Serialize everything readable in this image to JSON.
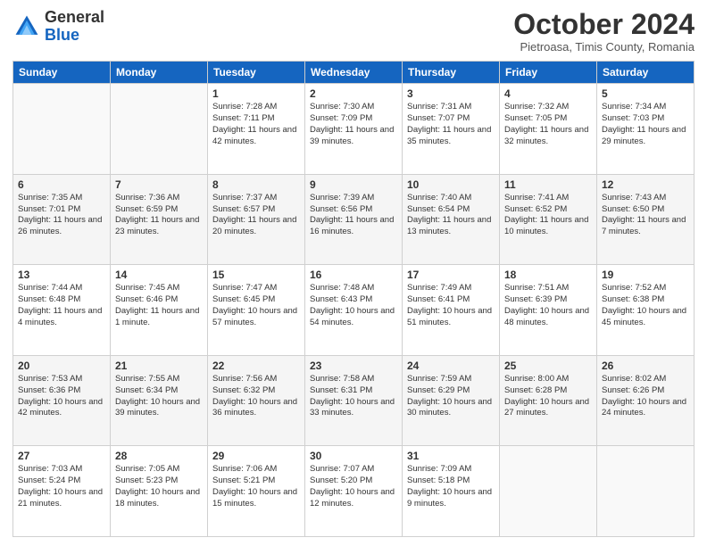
{
  "header": {
    "logo_general": "General",
    "logo_blue": "Blue",
    "month": "October 2024",
    "location": "Pietroasa, Timis County, Romania"
  },
  "days_of_week": [
    "Sunday",
    "Monday",
    "Tuesday",
    "Wednesday",
    "Thursday",
    "Friday",
    "Saturday"
  ],
  "weeks": [
    [
      {
        "day": "",
        "info": ""
      },
      {
        "day": "",
        "info": ""
      },
      {
        "day": "1",
        "info": "Sunrise: 7:28 AM\nSunset: 7:11 PM\nDaylight: 11 hours and 42 minutes."
      },
      {
        "day": "2",
        "info": "Sunrise: 7:30 AM\nSunset: 7:09 PM\nDaylight: 11 hours and 39 minutes."
      },
      {
        "day": "3",
        "info": "Sunrise: 7:31 AM\nSunset: 7:07 PM\nDaylight: 11 hours and 35 minutes."
      },
      {
        "day": "4",
        "info": "Sunrise: 7:32 AM\nSunset: 7:05 PM\nDaylight: 11 hours and 32 minutes."
      },
      {
        "day": "5",
        "info": "Sunrise: 7:34 AM\nSunset: 7:03 PM\nDaylight: 11 hours and 29 minutes."
      }
    ],
    [
      {
        "day": "6",
        "info": "Sunrise: 7:35 AM\nSunset: 7:01 PM\nDaylight: 11 hours and 26 minutes."
      },
      {
        "day": "7",
        "info": "Sunrise: 7:36 AM\nSunset: 6:59 PM\nDaylight: 11 hours and 23 minutes."
      },
      {
        "day": "8",
        "info": "Sunrise: 7:37 AM\nSunset: 6:57 PM\nDaylight: 11 hours and 20 minutes."
      },
      {
        "day": "9",
        "info": "Sunrise: 7:39 AM\nSunset: 6:56 PM\nDaylight: 11 hours and 16 minutes."
      },
      {
        "day": "10",
        "info": "Sunrise: 7:40 AM\nSunset: 6:54 PM\nDaylight: 11 hours and 13 minutes."
      },
      {
        "day": "11",
        "info": "Sunrise: 7:41 AM\nSunset: 6:52 PM\nDaylight: 11 hours and 10 minutes."
      },
      {
        "day": "12",
        "info": "Sunrise: 7:43 AM\nSunset: 6:50 PM\nDaylight: 11 hours and 7 minutes."
      }
    ],
    [
      {
        "day": "13",
        "info": "Sunrise: 7:44 AM\nSunset: 6:48 PM\nDaylight: 11 hours and 4 minutes."
      },
      {
        "day": "14",
        "info": "Sunrise: 7:45 AM\nSunset: 6:46 PM\nDaylight: 11 hours and 1 minute."
      },
      {
        "day": "15",
        "info": "Sunrise: 7:47 AM\nSunset: 6:45 PM\nDaylight: 10 hours and 57 minutes."
      },
      {
        "day": "16",
        "info": "Sunrise: 7:48 AM\nSunset: 6:43 PM\nDaylight: 10 hours and 54 minutes."
      },
      {
        "day": "17",
        "info": "Sunrise: 7:49 AM\nSunset: 6:41 PM\nDaylight: 10 hours and 51 minutes."
      },
      {
        "day": "18",
        "info": "Sunrise: 7:51 AM\nSunset: 6:39 PM\nDaylight: 10 hours and 48 minutes."
      },
      {
        "day": "19",
        "info": "Sunrise: 7:52 AM\nSunset: 6:38 PM\nDaylight: 10 hours and 45 minutes."
      }
    ],
    [
      {
        "day": "20",
        "info": "Sunrise: 7:53 AM\nSunset: 6:36 PM\nDaylight: 10 hours and 42 minutes."
      },
      {
        "day": "21",
        "info": "Sunrise: 7:55 AM\nSunset: 6:34 PM\nDaylight: 10 hours and 39 minutes."
      },
      {
        "day": "22",
        "info": "Sunrise: 7:56 AM\nSunset: 6:32 PM\nDaylight: 10 hours and 36 minutes."
      },
      {
        "day": "23",
        "info": "Sunrise: 7:58 AM\nSunset: 6:31 PM\nDaylight: 10 hours and 33 minutes."
      },
      {
        "day": "24",
        "info": "Sunrise: 7:59 AM\nSunset: 6:29 PM\nDaylight: 10 hours and 30 minutes."
      },
      {
        "day": "25",
        "info": "Sunrise: 8:00 AM\nSunset: 6:28 PM\nDaylight: 10 hours and 27 minutes."
      },
      {
        "day": "26",
        "info": "Sunrise: 8:02 AM\nSunset: 6:26 PM\nDaylight: 10 hours and 24 minutes."
      }
    ],
    [
      {
        "day": "27",
        "info": "Sunrise: 7:03 AM\nSunset: 5:24 PM\nDaylight: 10 hours and 21 minutes."
      },
      {
        "day": "28",
        "info": "Sunrise: 7:05 AM\nSunset: 5:23 PM\nDaylight: 10 hours and 18 minutes."
      },
      {
        "day": "29",
        "info": "Sunrise: 7:06 AM\nSunset: 5:21 PM\nDaylight: 10 hours and 15 minutes."
      },
      {
        "day": "30",
        "info": "Sunrise: 7:07 AM\nSunset: 5:20 PM\nDaylight: 10 hours and 12 minutes."
      },
      {
        "day": "31",
        "info": "Sunrise: 7:09 AM\nSunset: 5:18 PM\nDaylight: 10 hours and 9 minutes."
      },
      {
        "day": "",
        "info": ""
      },
      {
        "day": "",
        "info": ""
      }
    ]
  ]
}
